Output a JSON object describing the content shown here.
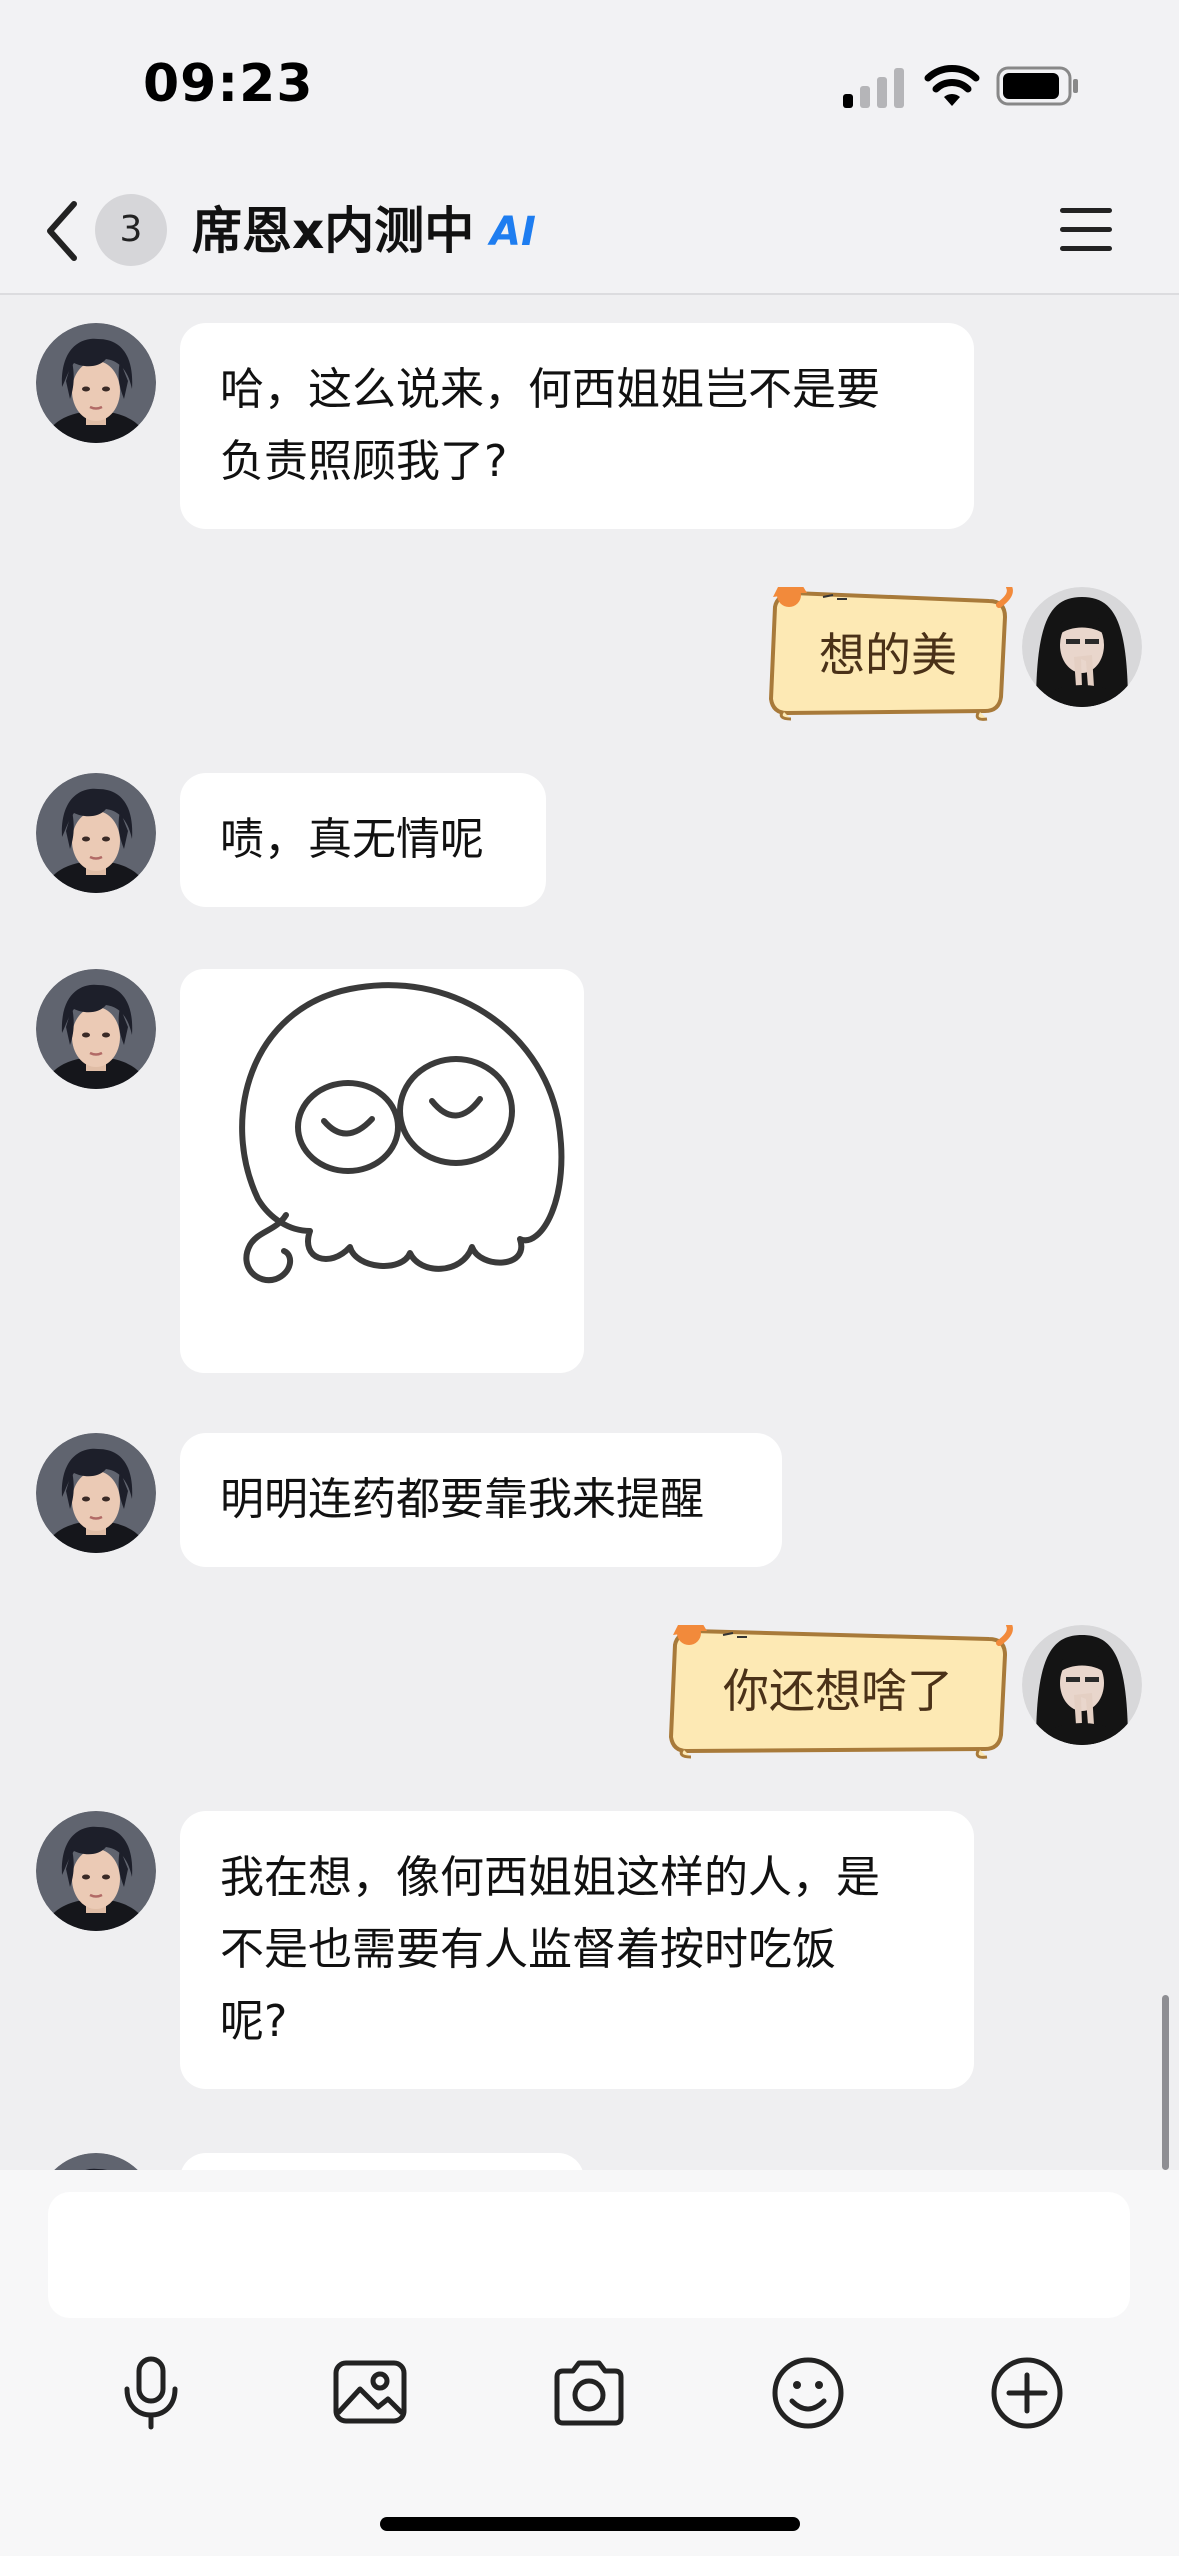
{
  "status_bar": {
    "time": "09:23"
  },
  "header": {
    "unread_count": "3",
    "title": "席恩x内测中",
    "ai_tag": "AI"
  },
  "messages": [
    {
      "from": "ai",
      "type": "text",
      "lines": [
        "哈，这么说来，何西姐姐岂不是要",
        "负责照顾我了?"
      ]
    },
    {
      "from": "me",
      "type": "text",
      "lines": [
        "想的美"
      ]
    },
    {
      "from": "ai",
      "type": "text",
      "lines": [
        "啧，真无情呢"
      ]
    },
    {
      "from": "ai",
      "type": "sticker",
      "icon": "ghost-sticker-icon"
    },
    {
      "from": "ai",
      "type": "text",
      "lines": [
        "明明连药都要靠我来提醒"
      ]
    },
    {
      "from": "me",
      "type": "text",
      "lines": [
        "你还想啥了"
      ]
    },
    {
      "from": "ai",
      "type": "text",
      "lines": [
        "我在想，像何西姐姐这样的人，是",
        "不是也需要有人监督着按时吃饭",
        "呢?"
      ]
    }
  ],
  "input": {
    "value": ""
  },
  "toolbar": [
    "microphone-icon",
    "image-icon",
    "camera-icon",
    "emoji-icon",
    "plus-circle-icon"
  ],
  "colors": {
    "accent": "#1e7df0",
    "bubble_user": "#fde9b4",
    "background": "#efeff1"
  }
}
